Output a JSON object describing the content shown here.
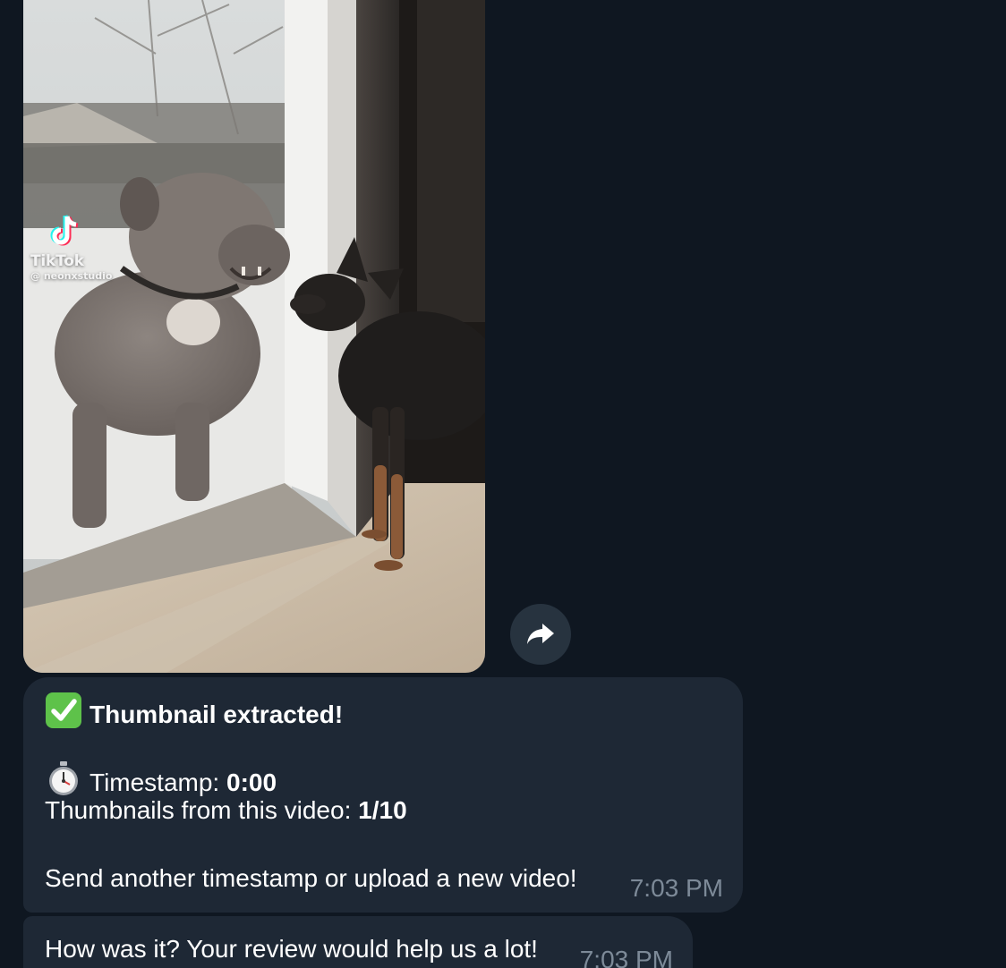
{
  "photo": {
    "watermark_brand": "TikTok",
    "watermark_user": "@ neonxstudio"
  },
  "forward_button": {
    "icon": "forward-arrow-icon"
  },
  "messages": [
    {
      "title_emoji": "check-mark-button-icon",
      "title": "Thumbnail extracted!",
      "timestamp_emoji": "stopwatch-icon",
      "timestamp_label": "Timestamp: ",
      "timestamp_value": "0:00",
      "count_label": "Thumbnails from this video: ",
      "count_value": "1/10",
      "footer": "Send another timestamp or upload a new video!",
      "time": "7:03 PM"
    },
    {
      "text": "How was it? Your review would help us a lot!",
      "time": "7:03 PM"
    }
  ],
  "colors": {
    "background": "#0f1721",
    "bubble": "#1e2835",
    "time_text": "#7d8a98",
    "check_green": "#5ec24a"
  }
}
